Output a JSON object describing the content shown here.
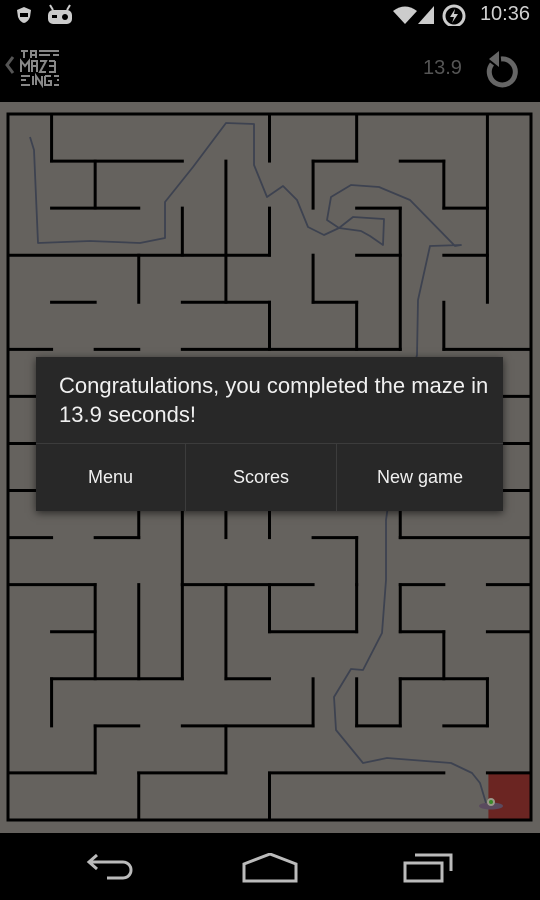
{
  "status_bar": {
    "time": "10:36",
    "icons": [
      "privacy-guard-icon",
      "cyanogenmod-icon",
      "wifi-icon",
      "signal-icon",
      "battery-charging-icon"
    ]
  },
  "action_bar": {
    "logo_text": "A MAZE ING",
    "elapsed_time": "13.9",
    "icons": [
      "back-chevron-icon",
      "app-logo",
      "restart-icon"
    ]
  },
  "game": {
    "maze_columns": 12,
    "maze_rows": 15,
    "goal_color": "#6b2522",
    "wall_color": "#000000",
    "floor_color": "#65625e",
    "path_color": "#3d4250",
    "player_icon": "ufo-icon"
  },
  "dialog": {
    "message": "Congratulations, you completed the maze in 13.9 seconds!",
    "buttons": [
      {
        "label": "Menu"
      },
      {
        "label": "Scores"
      },
      {
        "label": "New game"
      }
    ]
  },
  "nav_bar": {
    "icons": [
      "back-icon",
      "home-icon",
      "recents-icon"
    ]
  }
}
